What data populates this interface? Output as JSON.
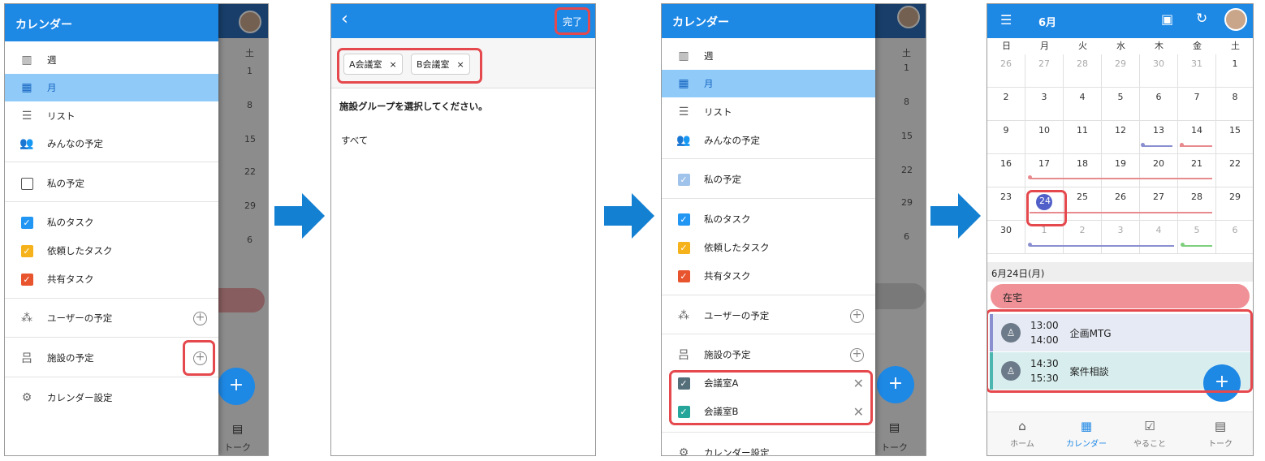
{
  "panel1": {
    "title": "カレンダー",
    "items": {
      "week": "週",
      "month": "月",
      "list": "リスト",
      "everyone": "みんなの予定",
      "mine": "私の予定",
      "mytask": "私のタスク",
      "reqtask": "依頼したタスク",
      "sharedtask": "共有タスク",
      "user": "ユーザーの予定",
      "facility": "施設の予定",
      "settings": "カレンダー設定"
    },
    "bg": {
      "sat": "土",
      "d1": "1",
      "d8": "8",
      "d15": "15",
      "d22": "22",
      "d29": "29",
      "d6": "6",
      "talk": "トーク"
    }
  },
  "panel2": {
    "done": "完了",
    "chips": [
      "A会議室",
      "B会議室"
    ],
    "prompt": "施設グループを選択してください。",
    "all": "すべて"
  },
  "panel3": {
    "title": "カレンダー",
    "items": {
      "week": "週",
      "month": "月",
      "list": "リスト",
      "everyone": "みんなの予定",
      "mine": "私の予定",
      "mytask": "私のタスク",
      "reqtask": "依頼したタスク",
      "sharedtask": "共有タスク",
      "user": "ユーザーの予定",
      "facility": "施設の予定",
      "roomA": "会議室A",
      "roomB": "会議室B",
      "settings": "カレンダー設定"
    },
    "bg": {
      "sat": "土",
      "d1": "1",
      "d8": "8",
      "d15": "15",
      "d22": "22",
      "d29": "29",
      "d6": "6",
      "talk": "トーク"
    }
  },
  "panel4": {
    "month": "6月",
    "weekdays": [
      "日",
      "月",
      "火",
      "水",
      "木",
      "金",
      "土"
    ],
    "weeks": [
      [
        "26",
        "27",
        "28",
        "29",
        "30",
        "31",
        "1"
      ],
      [
        "2",
        "3",
        "4",
        "5",
        "6",
        "7",
        "8"
      ],
      [
        "9",
        "10",
        "11",
        "12",
        "13",
        "14",
        "15"
      ],
      [
        "16",
        "17",
        "18",
        "19",
        "20",
        "21",
        "22"
      ],
      [
        "23",
        "24",
        "25",
        "26",
        "27",
        "28",
        "29"
      ],
      [
        "30",
        "1",
        "2",
        "3",
        "4",
        "5",
        "6"
      ]
    ],
    "selected_day": "6月24日(月)",
    "allday": "在宅",
    "events": [
      {
        "start": "13:00",
        "end": "14:00",
        "title": "企画MTG"
      },
      {
        "start": "14:30",
        "end": "15:30",
        "title": "案件相談"
      }
    ],
    "nav": [
      "ホーム",
      "カレンダー",
      "やること",
      "トーク"
    ]
  },
  "colors": {
    "primary": "#1e88e5",
    "active": "#90caf9",
    "highlight": "#e5484d"
  }
}
